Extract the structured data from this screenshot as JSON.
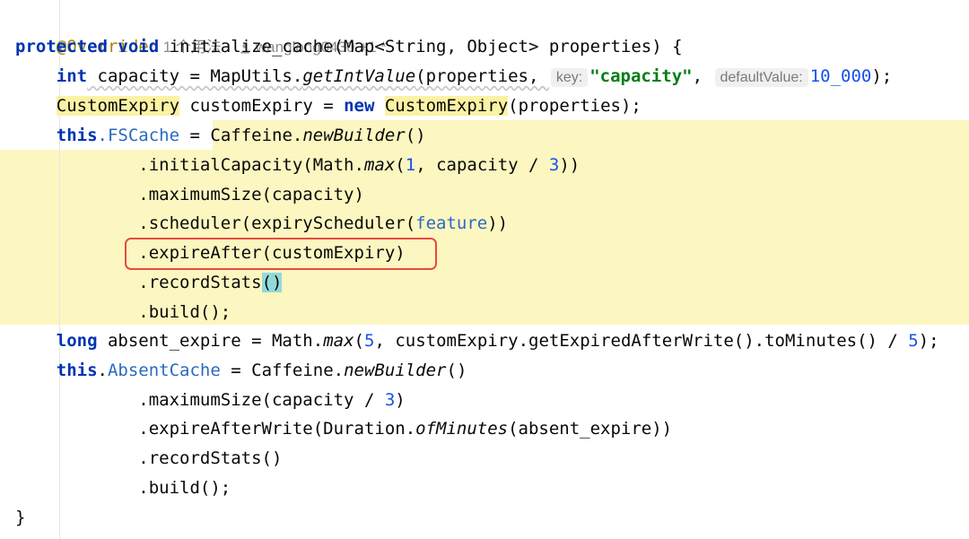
{
  "header": {
    "annotation": "@Override",
    "usages": "1 个用法",
    "author": "wanglong0430 +1 *"
  },
  "code": {
    "l1_keyword": "protected void",
    "l1_rest": " initialize_cache(Map<String, Object> properties) {",
    "l2_type": "int",
    "l2_a": " capacity = MapUtils.",
    "l2_method": "getIntValue",
    "l2_b": "(properties, ",
    "l2_hint_key": "key:",
    "l2_str": "\"capacity\"",
    "l2_comma": ", ",
    "l2_hint_default": "defaultValue:",
    "l2_num": "10_000",
    "l2_end": ");",
    "l3_type": "CustomExpiry",
    "l3_a": " customExpiry = ",
    "l3_new": "new",
    "l3_space": " ",
    "l3_class": "CustomExpiry",
    "l3_end": "(properties);",
    "l4_this": "this",
    "l4_field": ".FSCache",
    "l4_eq": " = ",
    "l4_class": "Caffeine.",
    "l4_method": "newBuilder",
    "l4_end": "()",
    "l5_a": ".initialCapacity(Math.",
    "l5_method": "max",
    "l5_b": "(",
    "l5_n1": "1",
    "l5_c": ", capacity / ",
    "l5_n2": "3",
    "l5_end": "))",
    "l6": ".maximumSize(capacity)",
    "l7_a": ".scheduler(expiryScheduler(",
    "l7_field": "feature",
    "l7_end": "))",
    "l8": ".expireAfter(customExpiry)",
    "l9_a": ".recordStats",
    "l9_paren": "()",
    "l10": ".build();",
    "l11_type": "long",
    "l11_a": " absent_expire = Math.",
    "l11_method": "max",
    "l11_b": "(",
    "l11_n1": "5",
    "l11_c": ", customExpiry.getExpiredAfterWrite().toMinutes() / ",
    "l11_n2": "5",
    "l11_end": ");",
    "l12_this": "this",
    "l12_dot": ".",
    "l12_field": "AbsentCache",
    "l12_a": " = Caffeine.",
    "l12_method": "newBuilder",
    "l12_end": "()",
    "l13_a": ".maximumSize(capacity / ",
    "l13_num": "3",
    "l13_end": ")",
    "l14_a": ".expireAfterWrite(Duration.",
    "l14_method": "ofMinutes",
    "l14_end": "(absent_expire))",
    "l15": ".recordStats()",
    "l16": ".build();",
    "l17": "}"
  },
  "colors": {
    "keyword": "#0033b3",
    "annotation": "#9e880d",
    "number": "#1750eb",
    "string": "#067d17",
    "highlight": "#fcf6c1",
    "callout_border": "#e84a3f"
  },
  "icons": {
    "author_icon": "person-icon"
  }
}
